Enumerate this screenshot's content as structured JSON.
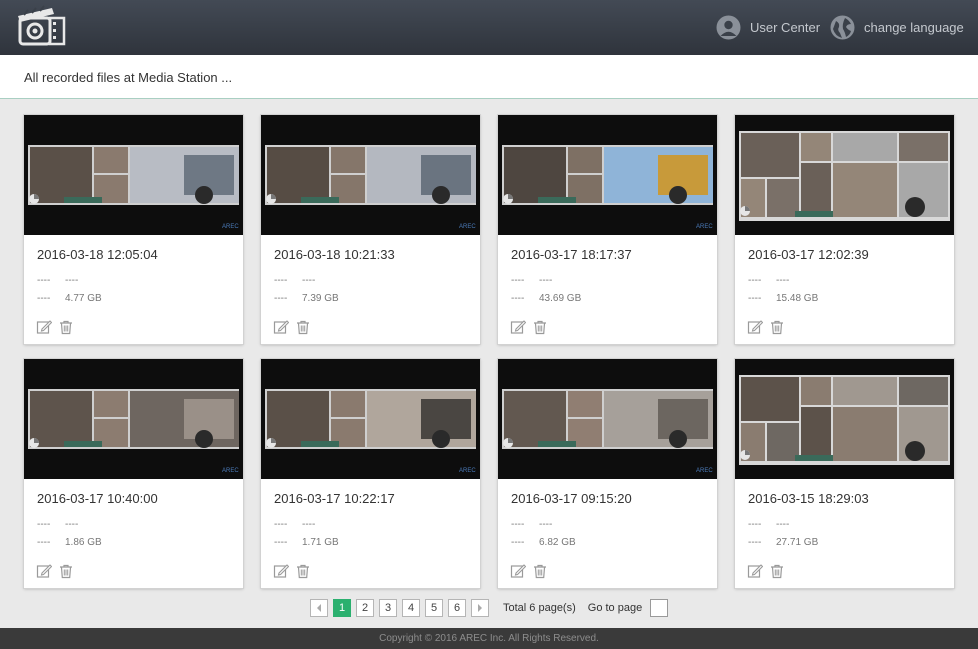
{
  "header": {
    "user_center_label": "User Center",
    "change_language_label": "change language"
  },
  "subheader": {
    "title": "All recorded files at Media Station ..."
  },
  "recordings": [
    {
      "date": "2016-03-18 12:05:04",
      "line1_a": "----",
      "line1_b": "----",
      "line2_a": "----",
      "size": "4.77 GB"
    },
    {
      "date": "2016-03-18 10:21:33",
      "line1_a": "----",
      "line1_b": "----",
      "line2_a": "----",
      "size": "7.39 GB"
    },
    {
      "date": "2016-03-17 18:17:37",
      "line1_a": "----",
      "line1_b": "----",
      "line2_a": "----",
      "size": "43.69 GB"
    },
    {
      "date": "2016-03-17 12:02:39",
      "line1_a": "----",
      "line1_b": "----",
      "line2_a": "----",
      "size": "15.48 GB"
    },
    {
      "date": "2016-03-17 10:40:00",
      "line1_a": "----",
      "line1_b": "----",
      "line2_a": "----",
      "size": "1.86 GB"
    },
    {
      "date": "2016-03-17 10:22:17",
      "line1_a": "----",
      "line1_b": "----",
      "line2_a": "----",
      "size": "1.71 GB"
    },
    {
      "date": "2016-03-17 09:15:20",
      "line1_a": "----",
      "line1_b": "----",
      "line2_a": "----",
      "size": "6.82 GB"
    },
    {
      "date": "2016-03-15 18:29:03",
      "line1_a": "----",
      "line1_b": "----",
      "line2_a": "----",
      "size": "27.71 GB"
    }
  ],
  "pagination": {
    "pages": [
      "1",
      "2",
      "3",
      "4",
      "5",
      "6"
    ],
    "current_page": "1",
    "total_label": "Total 6 page(s)",
    "goto_label": "Go to page",
    "prev_icon": "chevron-left-icon",
    "next_icon": "chevron-right-icon"
  },
  "footer": {
    "copyright": "Copyright © 2016 AREC Inc. All Rights Reserved."
  },
  "colors": {
    "header_bg": "#3a4049",
    "accent_green": "#2bb06f",
    "divider": "#a9cfc2",
    "footer_bg": "#3a3a3a"
  }
}
